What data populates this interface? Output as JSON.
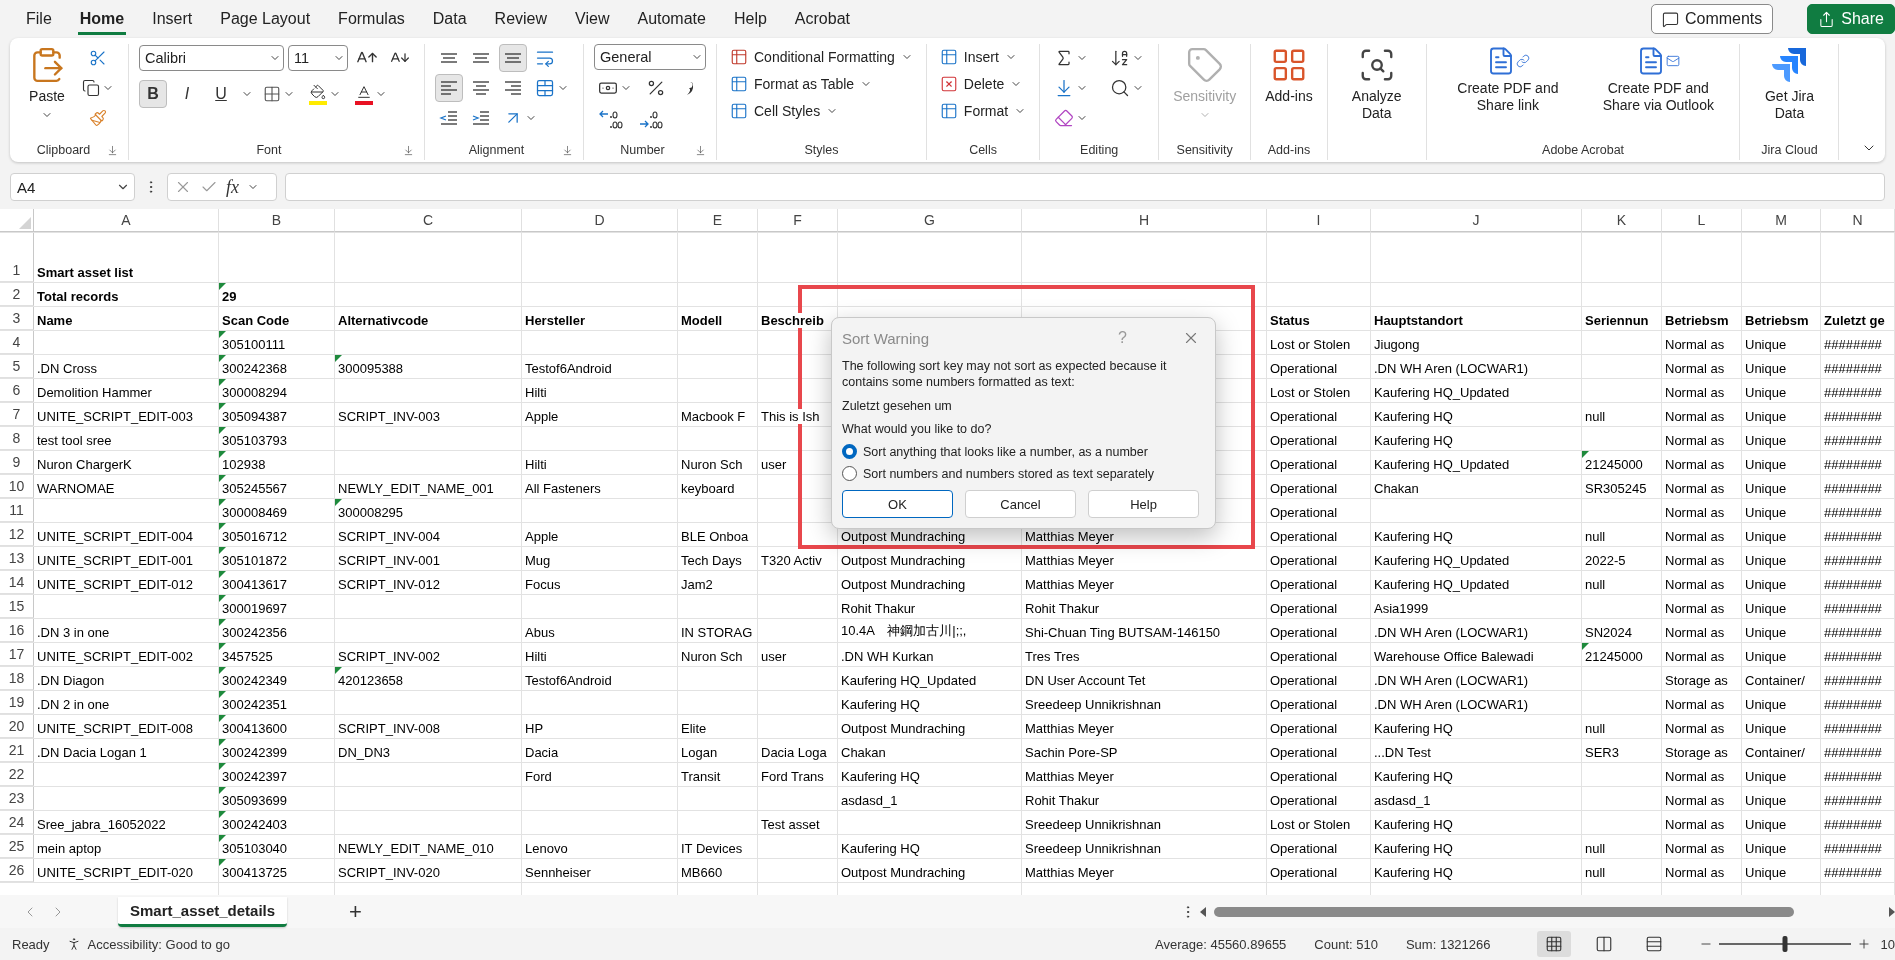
{
  "menu_tabs": [
    {
      "label": "File",
      "selected": false
    },
    {
      "label": "Home",
      "selected": true
    },
    {
      "label": "Insert",
      "selected": false
    },
    {
      "label": "Page Layout",
      "selected": false
    },
    {
      "label": "Formulas",
      "selected": false
    },
    {
      "label": "Data",
      "selected": false
    },
    {
      "label": "Review",
      "selected": false
    },
    {
      "label": "View",
      "selected": false
    },
    {
      "label": "Automate",
      "selected": false
    },
    {
      "label": "Help",
      "selected": false
    },
    {
      "label": "Acrobat",
      "selected": false
    }
  ],
  "header_buttons": [
    {
      "kind": "comments",
      "label": "Comments"
    },
    {
      "kind": "share",
      "label": "Share"
    }
  ],
  "ribbon_groups": [
    {
      "kind": "clipboard",
      "label": "Clipboard",
      "paste": "Paste"
    },
    {
      "kind": "font",
      "label": "Font",
      "font_name": "Calibri",
      "font_size": "11",
      "toggles": [
        {
          "kind": "bold",
          "text": "B",
          "pressed": true
        },
        {
          "kind": "italic",
          "text": "I",
          "pressed": false
        },
        {
          "kind": "underline",
          "text": "U",
          "pressed": false
        }
      ]
    },
    {
      "kind": "alignment",
      "label": "Alignment",
      "buttons": [
        {
          "kind": "top",
          "pressed": false
        },
        {
          "kind": "middle",
          "pressed": false
        },
        {
          "kind": "bottom",
          "pressed": true
        },
        {
          "kind": "wrap",
          "pressed": false
        },
        {
          "kind": "left",
          "pressed": true
        },
        {
          "kind": "center",
          "pressed": false
        },
        {
          "kind": "right",
          "pressed": false
        },
        {
          "kind": "merge",
          "pressed": false
        },
        {
          "kind": "indent_decrease",
          "pressed": false
        },
        {
          "kind": "indent_increase",
          "pressed": false
        },
        {
          "kind": "orientation",
          "pressed": false
        }
      ]
    },
    {
      "kind": "number",
      "label": "Number",
      "format": "General"
    },
    {
      "kind": "styles",
      "label": "Styles",
      "items": [
        {
          "kind": "conditional",
          "label": "Conditional Formatting"
        },
        {
          "kind": "table",
          "label": "Format as Table"
        },
        {
          "kind": "cell_styles",
          "label": "Cell Styles"
        }
      ]
    },
    {
      "kind": "cells",
      "label": "Cells",
      "items": [
        {
          "kind": "insert",
          "label": "Insert"
        },
        {
          "kind": "delete",
          "label": "Delete"
        },
        {
          "kind": "format",
          "label": "Format"
        }
      ]
    },
    {
      "kind": "editing",
      "label": "Editing"
    },
    {
      "kind": "large",
      "label": "Sensitivity",
      "buttons": [
        {
          "kind": "sensitivity",
          "label": "Sensitivity",
          "disabled": true
        }
      ]
    },
    {
      "kind": "large",
      "label": "Add-ins",
      "buttons": [
        {
          "kind": "addins",
          "label": "Add-ins",
          "disabled": false
        }
      ]
    },
    {
      "kind": "large",
      "buttons": [
        {
          "kind": "analyze",
          "label": "Analyze Data",
          "disabled": false
        }
      ]
    },
    {
      "kind": "large",
      "label": "Adobe Acrobat",
      "buttons": [
        {
          "kind": "pdf_link",
          "label": "Create PDF and Share link",
          "disabled": false
        },
        {
          "kind": "pdf_mail",
          "label": "Create PDF and Share via Outlook",
          "disabled": false
        }
      ]
    },
    {
      "kind": "large",
      "label": "Jira Cloud",
      "buttons": [
        {
          "kind": "jira",
          "label": "Get Jira Data",
          "disabled": false
        }
      ]
    }
  ],
  "formula_bar": {
    "name_box": "A4",
    "fx": "fx"
  },
  "columns": [
    "A",
    "B",
    "C",
    "D",
    "E",
    "F",
    "G",
    "H",
    "I",
    "J",
    "K",
    "L",
    "M",
    "N"
  ],
  "rows": [
    {
      "number": "1",
      "bold": true,
      "cells": {
        "A": "Smart asset list"
      }
    },
    {
      "number": "2",
      "bold": true,
      "cells": {
        "A": "Total records",
        "B": {
          "text": "29",
          "number_as_text": true
        }
      }
    },
    {
      "number": "3",
      "bold": true,
      "cells": {
        "A": "Name",
        "B": "Scan Code",
        "C": "Alternativcode",
        "D": "Hersteller",
        "E": "Modell",
        "F": "Beschreib",
        "I": "Status",
        "J": "Hauptstandort",
        "K": "Seriennun",
        "L": "Betriebsm",
        "M": "Betriebsm",
        "N": "Zuletzt ge"
      }
    },
    {
      "number": "4",
      "bold": false,
      "cells": {
        "B": {
          "text": "305100111",
          "number_as_text": true
        },
        "I": "Lost or Stolen",
        "J": "Jiugong",
        "L": "Normal as",
        "M": "Unique",
        "N": "########"
      }
    },
    {
      "number": "5",
      "bold": false,
      "cells": {
        "A": ".DN Cross",
        "B": {
          "text": "300242368",
          "number_as_text": true
        },
        "C": {
          "text": "300095388",
          "number_as_text": true
        },
        "D": "Testof6Android",
        "I": "Operational",
        "J": ".DN WH Aren (LOCWAR1)",
        "L": "Normal as",
        "M": "Unique",
        "N": "########"
      }
    },
    {
      "number": "6",
      "bold": false,
      "cells": {
        "A": "Demolition Hammer",
        "B": {
          "text": "300008294",
          "number_as_text": true
        },
        "D": "Hilti",
        "I": "Lost or Stolen",
        "J": "Kaufering HQ_Updated",
        "L": "Normal as",
        "M": "Unique",
        "N": "########"
      }
    },
    {
      "number": "7",
      "bold": false,
      "cells": {
        "A": "UNITE_SCRIPT_EDIT-003",
        "B": {
          "text": "305094387",
          "number_as_text": true
        },
        "C": "SCRIPT_INV-003",
        "D": "Apple",
        "E": "Macbook F",
        "F": "This is Ish",
        "I": "Operational",
        "J": "Kaufering HQ",
        "K": "null",
        "L": "Normal as",
        "M": "Unique",
        "N": "########"
      }
    },
    {
      "number": "8",
      "bold": false,
      "cells": {
        "A": "test tool sree",
        "B": {
          "text": "305103793",
          "number_as_text": true
        },
        "I": "Operational",
        "J": "Kaufering HQ",
        "L": "Normal as",
        "M": "Unique",
        "N": "########"
      }
    },
    {
      "number": "9",
      "bold": false,
      "cells": {
        "A": "Nuron ChargerK",
        "B": {
          "text": "102938",
          "number_as_text": true
        },
        "D": "Hilti",
        "E": "Nuron Sch",
        "F": "user",
        "I": "Operational",
        "J": "Kaufering HQ_Updated",
        "K": {
          "text": "21245000",
          "number_as_text": true
        },
        "L": "Normal as",
        "M": "Unique",
        "N": "########"
      }
    },
    {
      "number": "10",
      "bold": false,
      "cells": {
        "A": "WARNOMAE",
        "B": {
          "text": "305245567",
          "number_as_text": true
        },
        "C": "NEWLY_EDIT_NAME_001",
        "D": "All Fasteners",
        "E": "keyboard",
        "I": "Operational",
        "J": "Chakan",
        "K": "SR305245",
        "L": "Normal as",
        "M": "Unique",
        "N": "########"
      }
    },
    {
      "number": "11",
      "bold": false,
      "cells": {
        "B": {
          "text": "300008469",
          "number_as_text": true
        },
        "C": {
          "text": "300008295",
          "number_as_text": true
        },
        "I": "Operational",
        "L": "Normal as",
        "M": "Unique",
        "N": "########"
      }
    },
    {
      "number": "12",
      "bold": false,
      "cells": {
        "A": "UNITE_SCRIPT_EDIT-004",
        "B": {
          "text": "305016712",
          "number_as_text": true
        },
        "C": "SCRIPT_INV-004",
        "D": "Apple",
        "E": "BLE Onboa",
        "G": "Outpost Mundraching",
        "H": "Matthias Meyer",
        "I": "Operational",
        "J": "Kaufering HQ",
        "K": "null",
        "L": "Normal as",
        "M": "Unique",
        "N": "########"
      }
    },
    {
      "number": "13",
      "bold": false,
      "cells": {
        "A": "UNITE_SCRIPT_EDIT-001",
        "B": {
          "text": "305101872",
          "number_as_text": true
        },
        "C": "SCRIPT_INV-001",
        "D": "Mug",
        "E": "Tech Days",
        "F": "T320 Activ",
        "G": "Outpost Mundraching",
        "H": "Matthias Meyer",
        "I": "Operational",
        "J": "Kaufering HQ_Updated",
        "K": "2022-5",
        "L": "Normal as",
        "M": "Unique",
        "N": "########"
      }
    },
    {
      "number": "14",
      "bold": false,
      "cells": {
        "A": "UNITE_SCRIPT_EDIT-012",
        "B": {
          "text": "300413617",
          "number_as_text": true
        },
        "C": "SCRIPT_INV-012",
        "D": "Focus",
        "E": "Jam2",
        "G": "Outpost Mundraching",
        "H": "Matthias Meyer",
        "I": "Operational",
        "J": "Kaufering HQ_Updated",
        "K": "null",
        "L": "Normal as",
        "M": "Unique",
        "N": "########"
      }
    },
    {
      "number": "15",
      "bold": false,
      "cells": {
        "B": {
          "text": "300019697",
          "number_as_text": true
        },
        "G": "Rohit Thakur",
        "H": "Rohit Thakur",
        "I": "Operational",
        "J": "Asia1999",
        "L": "Normal as",
        "M": "Unique",
        "N": "########"
      }
    },
    {
      "number": "16",
      "bold": false,
      "cells": {
        "A": ".DN 3 in one",
        "B": {
          "text": "300242356",
          "number_as_text": true
        },
        "D": "Abus",
        "E": "IN STORAG",
        "G": "10.4A　神鋼加古川|;;,",
        "H": "Shi-Chuan Ting BUTSAM-146150",
        "I": "Operational",
        "J": ".DN WH Aren (LOCWAR1)",
        "K": "SN2024",
        "L": "Normal as",
        "M": "Unique",
        "N": "########"
      }
    },
    {
      "number": "17",
      "bold": false,
      "cells": {
        "A": "UNITE_SCRIPT_EDIT-002",
        "B": {
          "text": "3457525",
          "number_as_text": true
        },
        "C": "SCRIPT_INV-002",
        "D": "Hilti",
        "E": "Nuron Sch",
        "F": "user",
        "G": ".DN WH Kurkan",
        "H": "Tres Tres",
        "I": "Operational",
        "J": "Warehouse Office Balewadi",
        "K": {
          "text": "21245000",
          "number_as_text": true
        },
        "L": "Normal as",
        "M": "Unique",
        "N": "########"
      }
    },
    {
      "number": "18",
      "bold": false,
      "cells": {
        "A": ".DN Diagon",
        "B": {
          "text": "300242349",
          "number_as_text": true
        },
        "C": {
          "text": "420123658",
          "number_as_text": true
        },
        "D": "Testof6Android",
        "G": "Kaufering HQ_Updated",
        "H": "DN User Account Tet",
        "I": "Operational",
        "J": ".DN WH Aren (LOCWAR1)",
        "L": "Storage as",
        "M": "Container/",
        "N": "########"
      }
    },
    {
      "number": "19",
      "bold": false,
      "cells": {
        "A": ".DN 2 in one",
        "B": {
          "text": "300242351",
          "number_as_text": true
        },
        "G": "Kaufering HQ",
        "H": "Sreedeep Unnikrishnan",
        "I": "Operational",
        "J": ".DN WH Aren (LOCWAR1)",
        "L": "Normal as",
        "M": "Unique",
        "N": "########"
      }
    },
    {
      "number": "20",
      "bold": false,
      "cells": {
        "A": "UNITE_SCRIPT_EDIT-008",
        "B": {
          "text": "300413600",
          "number_as_text": true
        },
        "C": "SCRIPT_INV-008",
        "D": "HP",
        "E": "Elite",
        "G": "Outpost Mundraching",
        "H": "Matthias Meyer",
        "I": "Operational",
        "J": "Kaufering HQ",
        "K": "null",
        "L": "Normal as",
        "M": "Unique",
        "N": "########"
      }
    },
    {
      "number": "21",
      "bold": false,
      "cells": {
        "A": ".DN Dacia Logan 1",
        "B": {
          "text": "300242399",
          "number_as_text": true
        },
        "C": "DN_DN3",
        "D": "Dacia",
        "E": "Logan",
        "F": "Dacia Loga",
        "G": "Chakan",
        "H": "Sachin Pore-SP",
        "I": "Operational",
        "J": "...DN Test",
        "K": "SER3",
        "L": "Storage as",
        "M": "Container/",
        "N": "########"
      }
    },
    {
      "number": "22",
      "bold": false,
      "cells": {
        "B": {
          "text": "300242397",
          "number_as_text": true
        },
        "D": "Ford",
        "E": "Transit",
        "F": "Ford Trans",
        "G": "Kaufering HQ",
        "H": "Matthias Meyer",
        "I": "Operational",
        "J": "Kaufering HQ",
        "L": "Normal as",
        "M": "Unique",
        "N": "########"
      }
    },
    {
      "number": "23",
      "bold": false,
      "cells": {
        "B": {
          "text": "305093699",
          "number_as_text": true
        },
        "G": "asdasd_1",
        "H": "Rohit Thakur",
        "I": "Operational",
        "J": "asdasd_1",
        "L": "Normal as",
        "M": "Unique",
        "N": "########"
      }
    },
    {
      "number": "24",
      "bold": false,
      "cells": {
        "A": "Sree_jabra_16052022",
        "B": {
          "text": "300242403",
          "number_as_text": true
        },
        "F": "Test asset",
        "H": "Sreedeep Unnikrishnan",
        "I": "Lost or Stolen",
        "J": "Kaufering HQ",
        "L": "Normal as",
        "M": "Unique",
        "N": "########"
      }
    },
    {
      "number": "25",
      "bold": false,
      "cells": {
        "A": "mein aptop",
        "B": {
          "text": "305103040",
          "number_as_text": true
        },
        "C": "NEWLY_EDIT_NAME_010",
        "D": "Lenovo",
        "E": "IT Devices",
        "G": "Kaufering HQ",
        "H": "Sreedeep Unnikrishnan",
        "I": "Operational",
        "J": "Kaufering HQ",
        "K": "null",
        "L": "Normal as",
        "M": "Unique",
        "N": "########"
      }
    },
    {
      "number": "26",
      "bold": false,
      "cells": {
        "A": "UNITE_SCRIPT_EDIT-020",
        "B": {
          "text": "300413725",
          "number_as_text": true
        },
        "C": "SCRIPT_INV-020",
        "D": "Sennheiser",
        "E": "MB660",
        "G": "Outpost Mundraching",
        "H": "Matthias Meyer",
        "I": "Operational",
        "J": "Kaufering HQ",
        "K": "null",
        "L": "Normal as",
        "M": "Unique",
        "N": "########"
      }
    }
  ],
  "dialog": {
    "title": "Sort Warning",
    "help": "?",
    "message": "The following sort key may not sort as expected because it contains some numbers formatted as text:",
    "key": "Zuletzt gesehen um",
    "question": "What would you like to do?",
    "options": [
      {
        "label": "Sort anything that looks like a number, as a number",
        "selected": true
      },
      {
        "label": "Sort numbers and numbers stored as text separately",
        "selected": false
      }
    ],
    "buttons": [
      {
        "label": "OK",
        "default": true
      },
      {
        "label": "Cancel",
        "default": false
      },
      {
        "label": "Help",
        "default": false
      }
    ]
  },
  "sheet_tabs": [
    {
      "label": "Smart_asset_details",
      "selected": true
    }
  ],
  "add_sheet": "+",
  "status_bar": {
    "mode": "Ready",
    "accessibility": "Accessibility: Good to go",
    "stats": [
      "Average: 45560.89655",
      "Count: 510",
      "Sum: 1321266"
    ],
    "views": [
      {
        "kind": "normal",
        "selected": true
      },
      {
        "kind": "page_layout",
        "selected": false
      },
      {
        "kind": "page_break",
        "selected": false
      }
    ],
    "zoom": {
      "level": 0.5,
      "text": "10"
    }
  }
}
